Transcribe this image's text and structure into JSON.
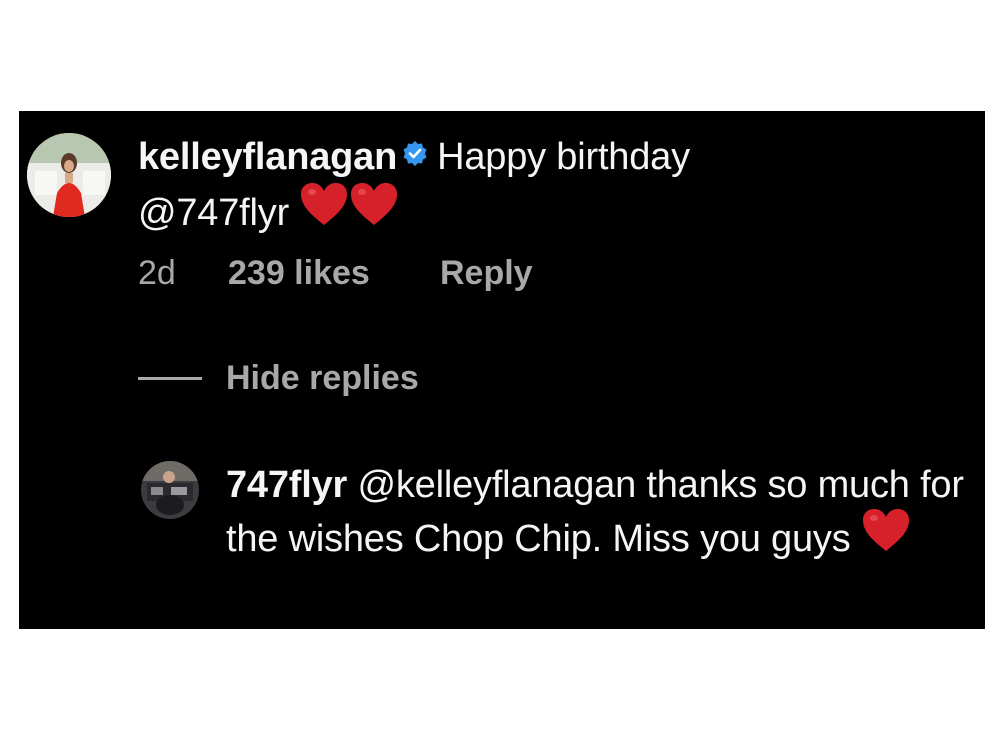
{
  "comment": {
    "username": "kelleyflanagan",
    "verified": true,
    "text_before_mention": "Happy birthday",
    "mention": "@747flyr",
    "time": "2d",
    "likes": "239 likes",
    "reply_label": "Reply",
    "hearts_count": 2
  },
  "replies_toggle": {
    "label": "Hide replies"
  },
  "reply": {
    "username": "747flyr",
    "mention": "@kelleyflanagan",
    "text": "thanks so much for the wishes Chop Chip. Miss you guys",
    "hearts_count": 1
  },
  "colors": {
    "background": "#000000",
    "text": "#f5f5f5",
    "muted": "#a8a8a8",
    "verified_badge": "#3797f0",
    "heart": "#d6202a"
  },
  "icons": {
    "verified": "verified-badge-icon",
    "heart": "red-heart-icon"
  }
}
